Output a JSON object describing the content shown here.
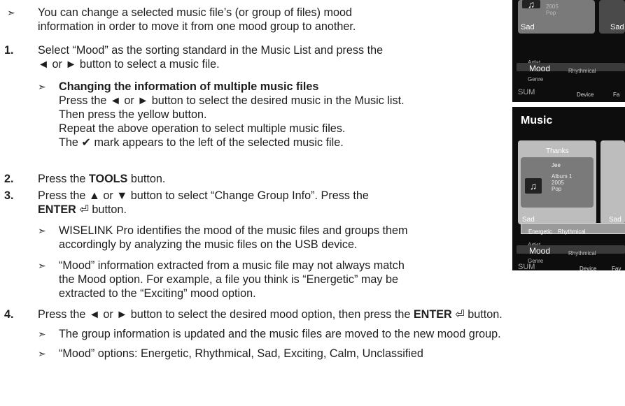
{
  "intro": {
    "line1": "You can change a selected music file’s (or group of files) mood",
    "line2": "information in order to move it from one mood group to another."
  },
  "step1": {
    "num": "1.",
    "line1": "Select “Mood” as the sorting standard in the Music List and press the",
    "line2": "◄ or ► button to select a music file.",
    "sub_title": "Changing the information of multiple music files",
    "sub_l1": "Press the ◄ or ► button to select the desired music in the Music list.",
    "sub_l2": "Then press the yellow button.",
    "sub_l3": "Repeat the above operation to select multiple music files.",
    "sub_l4": "The ✔ mark appears to the left of the selected music file."
  },
  "step2": {
    "num": "2.",
    "pre": "Press the ",
    "bold": "TOOLS",
    "post": " button."
  },
  "step3": {
    "num": "3.",
    "line1": "Press the ▲ or ▼ button to select “Change Group Info”. Press the",
    "line2_bold": "ENTER",
    "line2_post": " ⏎ button.",
    "n1_l1": "WISELINK Pro identifies the mood of the music files and groups them",
    "n1_l2": "accordingly by analyzing the music files on the USB device.",
    "n2_l1": "“Mood” information extracted from a music file may not always match",
    "n2_l2": "the Mood option. For example, a file you think is “Energetic” may be",
    "n2_l3": "extracted to the “Exciting” mood option."
  },
  "step4": {
    "num": "4.",
    "pre": "Press the ◄ or ► button to select the desired mood option, then press the ",
    "bold": "ENTER",
    "post": " ⏎ button.",
    "n1": "The group information is updated and the music files are moved to the new mood group.",
    "n2": "“Mood” options: Energetic, Rhythmical, Sad, Exciting, Calm, Unclassified"
  },
  "screen1": {
    "year": "2005",
    "genre": "Pop",
    "sad": "Sad",
    "sad2": "Sad",
    "artist": "Artist",
    "mood": "Mood",
    "rhythmical": "Rhythmical",
    "genre_lbl": "Genre",
    "sum": "SUM",
    "device": "Device",
    "fav": "Fa"
  },
  "screen2": {
    "title": "Music",
    "thanks": "Thanks",
    "jee": "Jee",
    "album": "Album 1",
    "year": "2005",
    "genre": "Pop",
    "sad": "Sad",
    "sad2": "Sad",
    "energetic": "Energetic",
    "rhythmical_hl": "Rhythmical",
    "artist": "Artist",
    "mood": "Mood",
    "rhythmical": "Rhythmical",
    "genre_lbl": "Genre",
    "sum": "SUM",
    "device": "Device",
    "fav": "Fav"
  },
  "glyphs": {
    "note_arrow": "➣",
    "music_note": "♫"
  }
}
